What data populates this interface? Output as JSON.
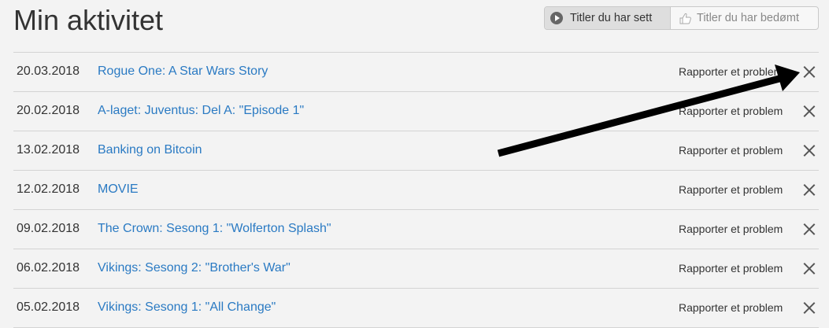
{
  "header": {
    "title": "Min aktivitet"
  },
  "toggle": {
    "watched_label": "Titler du har sett",
    "rated_label": "Titler du har bedømt",
    "active": "watched",
    "watched_icon": "play-icon",
    "rated_icon": "thumbs-up-icon"
  },
  "activity": {
    "report_label": "Rapporter et problem",
    "remove_icon": "close-icon",
    "rows": [
      {
        "date": "20.03.2018",
        "title": "Rogue One: A Star Wars Story"
      },
      {
        "date": "20.02.2018",
        "title": "A-laget: Juventus: Del A: \"Episode 1\""
      },
      {
        "date": "13.02.2018",
        "title": "Banking on Bitcoin"
      },
      {
        "date": "12.02.2018",
        "title": "MOVIE"
      },
      {
        "date": "09.02.2018",
        "title": "The Crown: Sesong 1: \"Wolferton Splash\""
      },
      {
        "date": "06.02.2018",
        "title": "Vikings: Sesong 2: \"Brother's War\""
      },
      {
        "date": "05.02.2018",
        "title": "Vikings: Sesong 1: \"All Change\""
      }
    ]
  },
  "annotation": {
    "arrow_icon": "annotation-arrow",
    "arrow_color": "#000000"
  },
  "colors": {
    "background": "#f3f3f3",
    "link": "#2a7ac3",
    "text": "#333333",
    "divider": "#d3d3d3"
  }
}
